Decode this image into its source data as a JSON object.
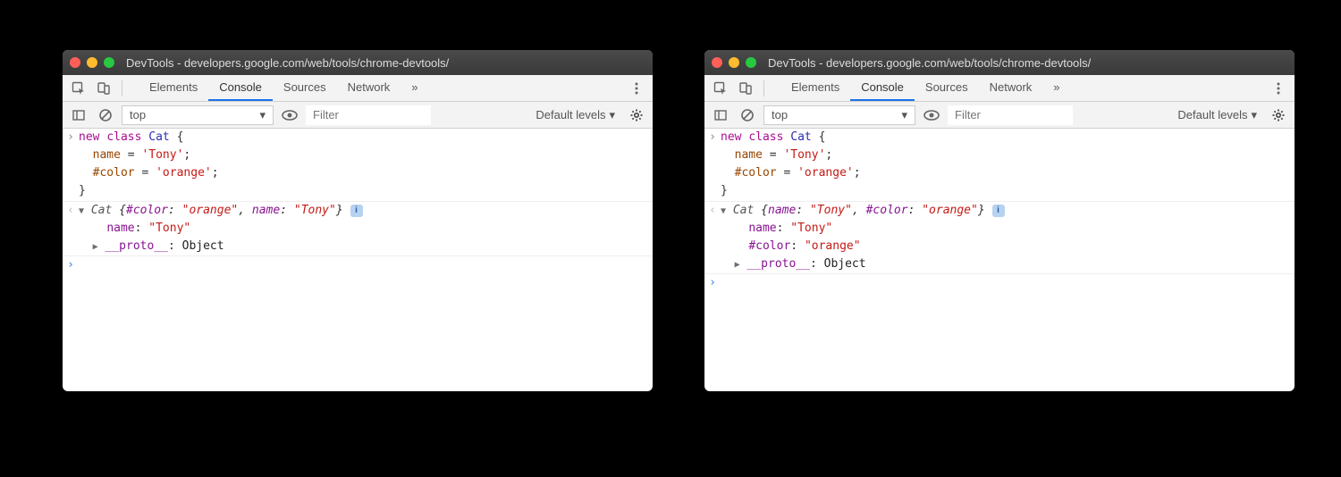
{
  "title": "DevTools - developers.google.com/web/tools/chrome-devtools/",
  "tabs": {
    "elements": "Elements",
    "console": "Console",
    "sources": "Sources",
    "network": "Network"
  },
  "subbar": {
    "context": "top",
    "filter_placeholder": "Filter",
    "levels": "Default levels"
  },
  "input_code": "new class Cat {\n  name = 'Tony';\n  #color = 'orange';\n}",
  "left": {
    "summary": "Cat {#color: \"orange\", name: \"Tony\"}",
    "expanded": [
      {
        "key": "name",
        "value": "\"Tony\""
      }
    ],
    "proto": {
      "label": "__proto__",
      "value": "Object"
    }
  },
  "right": {
    "summary": "Cat {name: \"Tony\", #color: \"orange\"}",
    "expanded": [
      {
        "key": "name",
        "value": "\"Tony\""
      },
      {
        "key": "#color",
        "value": "\"orange\""
      }
    ],
    "proto": {
      "label": "__proto__",
      "value": "Object"
    }
  },
  "info_badge": "i"
}
